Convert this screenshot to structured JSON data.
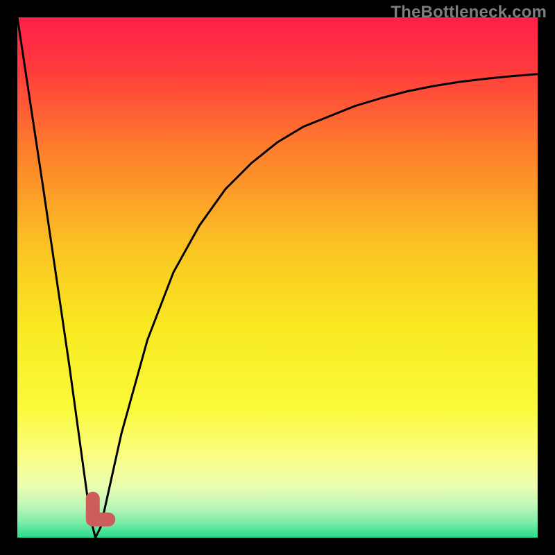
{
  "watermark": "TheBottleneck.com",
  "chart_data": {
    "type": "line",
    "title": "",
    "xlabel": "",
    "ylabel": "",
    "xlim": [
      0,
      100
    ],
    "ylim": [
      0,
      100
    ],
    "grid": false,
    "series": [
      {
        "name": "bottleneck-curve",
        "x": [
          0,
          5,
          10,
          14,
          15,
          16,
          20,
          25,
          30,
          35,
          40,
          45,
          50,
          55,
          60,
          65,
          70,
          75,
          80,
          85,
          90,
          95,
          100
        ],
        "y": [
          100,
          67,
          33,
          4,
          0,
          2,
          20,
          38,
          51,
          60,
          67,
          72,
          76,
          79,
          81,
          83,
          84.5,
          85.8,
          86.8,
          87.6,
          88.2,
          88.7,
          89.1
        ]
      }
    ],
    "marker": {
      "name": "current-point",
      "color": "#cd5d5a",
      "xy_path": [
        [
          14.5,
          7.5
        ],
        [
          14.5,
          3.5
        ],
        [
          17.5,
          3.5
        ]
      ]
    },
    "background_gradient": {
      "stops": [
        {
          "offset": 0.0,
          "color": "#ff1f49"
        },
        {
          "offset": 0.1,
          "color": "#ff3b3d"
        },
        {
          "offset": 0.25,
          "color": "#fe7d2c"
        },
        {
          "offset": 0.45,
          "color": "#fac623"
        },
        {
          "offset": 0.6,
          "color": "#f8ea21"
        },
        {
          "offset": 0.75,
          "color": "#faf93a"
        },
        {
          "offset": 0.84,
          "color": "#fbfd80"
        },
        {
          "offset": 0.9,
          "color": "#ecfdb0"
        },
        {
          "offset": 0.94,
          "color": "#bef6b8"
        },
        {
          "offset": 0.97,
          "color": "#7eeda8"
        },
        {
          "offset": 1.0,
          "color": "#26db8a"
        }
      ]
    }
  }
}
